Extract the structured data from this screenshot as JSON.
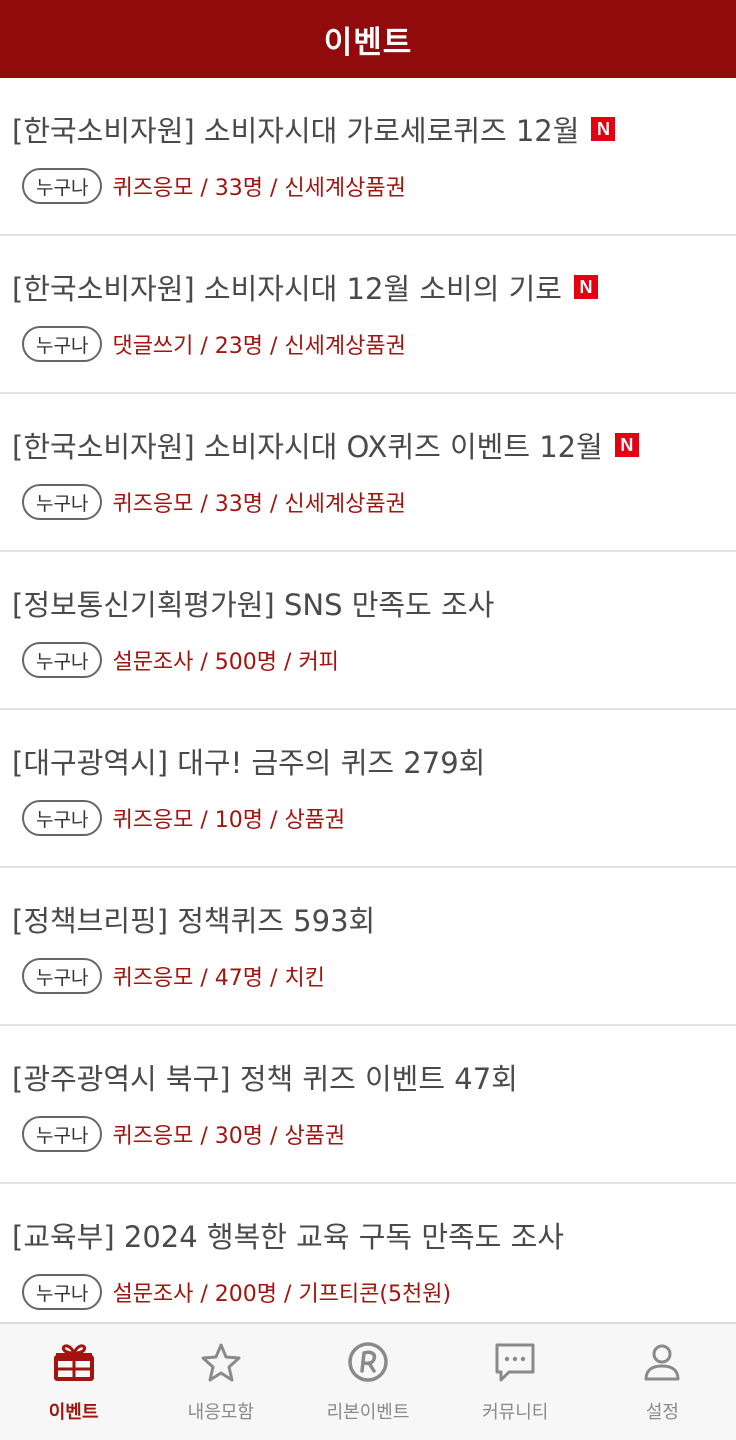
{
  "header": {
    "title": "이벤트"
  },
  "colors": {
    "brand": "#920b0c",
    "accent": "#a3140f",
    "new_badge": "#e40011"
  },
  "events": [
    {
      "title": "[한국소비자원] 소비자시대 가로세로퀴즈 12월",
      "is_new": true,
      "new_label": "N",
      "target": "누구나",
      "info": "퀴즈응모 / 33명 / 신세계상품권"
    },
    {
      "title": "[한국소비자원] 소비자시대 12월 소비의 기로",
      "is_new": true,
      "new_label": "N",
      "target": "누구나",
      "info": "댓글쓰기 / 23명 / 신세계상품권"
    },
    {
      "title": "[한국소비자원] 소비자시대 OX퀴즈 이벤트 12월",
      "is_new": true,
      "new_label": "N",
      "target": "누구나",
      "info": "퀴즈응모 / 33명 / 신세계상품권"
    },
    {
      "title": "[정보통신기획평가원] SNS 만족도 조사",
      "is_new": false,
      "target": "누구나",
      "info": "설문조사 / 500명 / 커피"
    },
    {
      "title": "[대구광역시] 대구! 금주의 퀴즈 279회",
      "is_new": false,
      "target": "누구나",
      "info": "퀴즈응모 / 10명 / 상품권"
    },
    {
      "title": "[정책브리핑] 정책퀴즈 593회",
      "is_new": false,
      "target": "누구나",
      "info": "퀴즈응모 / 47명 / 치킨"
    },
    {
      "title": "[광주광역시 북구] 정책 퀴즈 이벤트 47회",
      "is_new": false,
      "target": "누구나",
      "info": "퀴즈응모 / 30명 / 상품권"
    },
    {
      "title": "[교육부] 2024 행복한 교육 구독 만족도 조사",
      "is_new": false,
      "target": "누구나",
      "info": "설문조사 / 200명 / 기프티콘(5천원)"
    }
  ],
  "tabs": [
    {
      "label": "이벤트",
      "icon": "gift-icon",
      "active": true
    },
    {
      "label": "내응모함",
      "icon": "star-icon",
      "active": false
    },
    {
      "label": "리본이벤트",
      "icon": "r-logo-icon",
      "active": false
    },
    {
      "label": "커뮤니티",
      "icon": "chat-icon",
      "active": false
    },
    {
      "label": "설정",
      "icon": "person-icon",
      "active": false
    }
  ]
}
